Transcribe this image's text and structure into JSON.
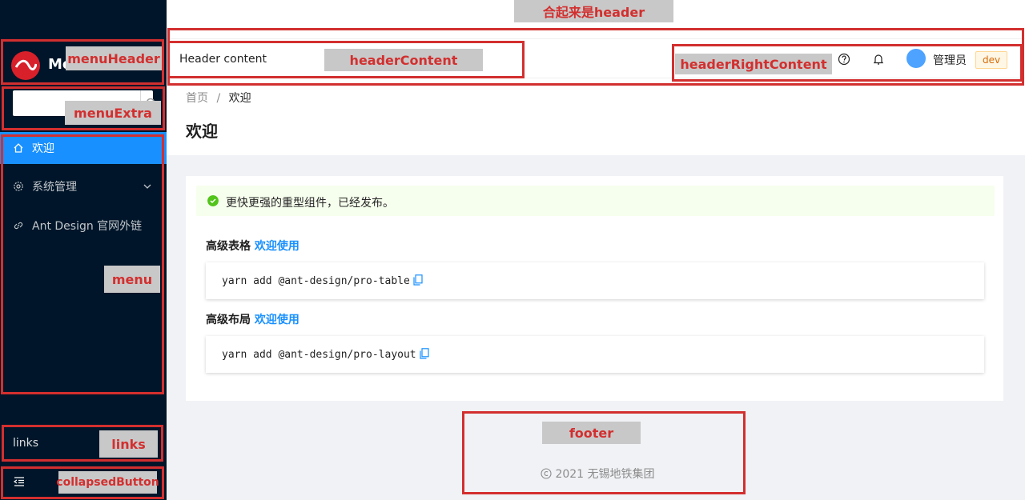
{
  "sidebar": {
    "logo_text": "Me",
    "menu": [
      {
        "label": "欢迎",
        "icon": "home-icon",
        "active": true
      },
      {
        "label": "系统管理",
        "icon": "setting-icon",
        "active": false,
        "has_submenu": true
      },
      {
        "label": "Ant Design 官网外链",
        "icon": "link-icon",
        "active": false
      }
    ],
    "links_label": "links"
  },
  "header": {
    "content": "Header content",
    "user": "管理员",
    "env": "dev"
  },
  "page": {
    "breadcrumb_home": "首页",
    "breadcrumb_sep": "/",
    "breadcrumb_current": "欢迎",
    "title": "欢迎"
  },
  "content": {
    "alert": "更快更强的重型组件，已经发布。",
    "sections": [
      {
        "title": "高级表格",
        "link": "欢迎使用",
        "code": "yarn add @ant-design/pro-table"
      },
      {
        "title": "高级布局",
        "link": "欢迎使用",
        "code": "yarn add @ant-design/pro-layout"
      }
    ]
  },
  "footer": {
    "text": "2021 无锡地铁集团"
  },
  "annotations": {
    "header": "合起来是header",
    "menuHeader": "menuHeader",
    "menuExtra": "menuExtra",
    "menu": "menu",
    "links": "links",
    "collapsedButton": "collapsedButton",
    "headerContent": "headerContent",
    "headerRightContent": "headerRightContent",
    "footer": "footer"
  },
  "colors": {
    "sider_bg": "#001529",
    "primary": "#1890ff",
    "annotation": "#d32f2f",
    "success": "#52c41a"
  }
}
